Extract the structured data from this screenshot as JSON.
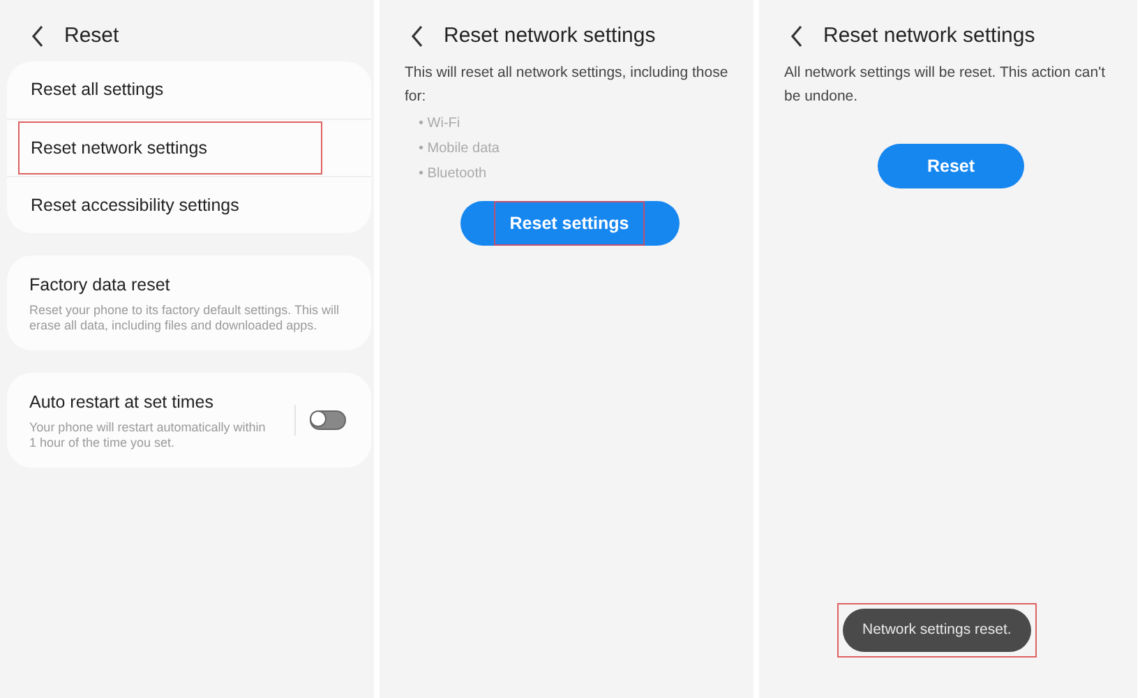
{
  "screens": [
    {
      "kind": "menu",
      "title": "Reset",
      "groups": [
        {
          "items": [
            {
              "label": "Reset all settings",
              "highlighted": false
            },
            {
              "label": "Reset network settings",
              "highlighted": true
            },
            {
              "label": "Reset accessibility settings",
              "highlighted": false
            }
          ]
        },
        {
          "items": [
            {
              "label": "Factory data reset",
              "description": "Reset your phone to its factory default settings. This will erase all data, including files and downloaded apps.",
              "highlighted": false
            }
          ]
        },
        {
          "items": [
            {
              "label": "Auto restart at set times",
              "description": "Your phone will restart automatically within 1 hour of the time you set.",
              "highlighted": false,
              "toggle": {
                "on": false
              }
            }
          ]
        }
      ]
    },
    {
      "kind": "confirm",
      "title": "Reset network settings",
      "text": "This will reset all network settings, including those for:",
      "bullets": [
        "• Wi-Fi",
        "• Mobile data",
        "• Bluetooth"
      ],
      "button": {
        "label": "Reset settings",
        "highlighted": true
      }
    },
    {
      "kind": "confirm",
      "title": "Reset network settings",
      "text": "All network settings will be reset. This action can't be undone.",
      "button": {
        "label": "Reset",
        "highlighted": false
      },
      "toast": {
        "text": "Network settings reset.",
        "highlighted": true
      }
    }
  ]
}
